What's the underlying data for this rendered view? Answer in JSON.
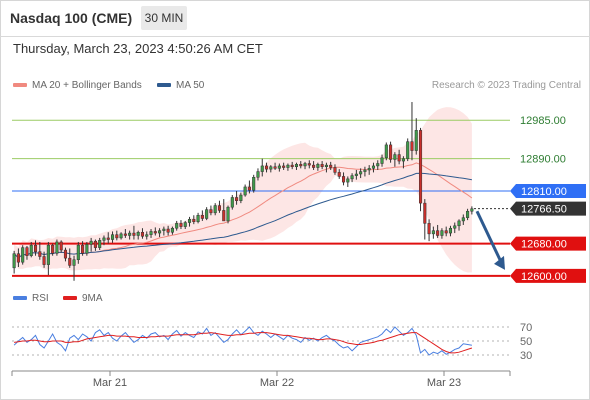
{
  "header": {
    "instrument": "Nasdaq 100 (CME)",
    "timeframe": "30 MIN",
    "timestamp": "Thursday, March 23, 2023 4:50:26 AM CET"
  },
  "legend": {
    "ma20_label": "MA 20 + Bollinger Bands",
    "ma20_color": "#f08a80",
    "ma50_label": "MA 50",
    "ma50_color": "#2e5a8f",
    "credit": "Research © 2023 Trading Central"
  },
  "rsi_legend": {
    "rsi_label": "RSI",
    "rsi_color": "#4a7fe0",
    "ma_label": "9MA",
    "ma_color": "#e02020"
  },
  "chart_data": [
    {
      "type": "candlestick",
      "title": "Nasdaq 100 (CME) 30 MIN",
      "x_labels": [
        "Mar 21",
        "Mar 22",
        "Mar 23"
      ],
      "ylim": [
        12585,
        13035
      ],
      "grid": false,
      "levels": [
        {
          "label": "12985.00",
          "value": 12985,
          "kind": "resistance",
          "color": "#9ccc65"
        },
        {
          "label": "12890.00",
          "value": 12890,
          "kind": "resistance",
          "color": "#9ccc65"
        },
        {
          "label": "12810.00",
          "value": 12810,
          "kind": "pivot",
          "color": "#2f6ff5"
        },
        {
          "label": "12766.50",
          "value": 12766.5,
          "kind": "last_price",
          "color": "#333333"
        },
        {
          "label": "12680.00",
          "value": 12680,
          "kind": "support",
          "color": "#e01010"
        },
        {
          "label": "12600.00",
          "value": 12600,
          "kind": "support",
          "color": "#e01010"
        }
      ],
      "forecast_arrow": {
        "from": 12760,
        "to": 12615,
        "direction": "down",
        "color": "#2e5a8f"
      },
      "candles": [
        [
          12620,
          12662,
          12606,
          12655
        ],
        [
          12655,
          12668,
          12622,
          12634
        ],
        [
          12634,
          12676,
          12628,
          12670
        ],
        [
          12670,
          12674,
          12640,
          12650
        ],
        [
          12650,
          12684,
          12646,
          12676
        ],
        [
          12676,
          12688,
          12650,
          12660
        ],
        [
          12660,
          12684,
          12640,
          12648
        ],
        [
          12648,
          12660,
          12620,
          12628
        ],
        [
          12628,
          12684,
          12602,
          12676
        ],
        [
          12676,
          12680,
          12650,
          12656
        ],
        [
          12656,
          12690,
          12650,
          12684
        ],
        [
          12684,
          12688,
          12658,
          12664
        ],
        [
          12664,
          12670,
          12636,
          12644
        ],
        [
          12644,
          12668,
          12620,
          12626
        ],
        [
          12626,
          12650,
          12588,
          12640
        ],
        [
          12640,
          12684,
          12630,
          12676
        ],
        [
          12676,
          12686,
          12650,
          12656
        ],
        [
          12656,
          12684,
          12650,
          12678
        ],
        [
          12678,
          12694,
          12660,
          12686
        ],
        [
          12686,
          12690,
          12662,
          12670
        ],
        [
          12670,
          12694,
          12664,
          12688
        ],
        [
          12688,
          12700,
          12676,
          12694
        ],
        [
          12694,
          12708,
          12680,
          12690
        ],
        [
          12690,
          12710,
          12682,
          12702
        ],
        [
          12702,
          12712,
          12688,
          12694
        ],
        [
          12694,
          12708,
          12690,
          12704
        ],
        [
          12704,
          12716,
          12694,
          12700
        ],
        [
          12700,
          12712,
          12690,
          12706
        ],
        [
          12706,
          12724,
          12690,
          12700
        ],
        [
          12700,
          12712,
          12690,
          12708
        ],
        [
          12708,
          12718,
          12692,
          12698
        ],
        [
          12698,
          12710,
          12690,
          12702
        ],
        [
          12702,
          12716,
          12694,
          12710
        ],
        [
          12710,
          12720,
          12700,
          12706
        ],
        [
          12706,
          12718,
          12696,
          12712
        ],
        [
          12712,
          12722,
          12700,
          12716
        ],
        [
          12716,
          12724,
          12700,
          12708
        ],
        [
          12708,
          12722,
          12702,
          12718
        ],
        [
          12718,
          12736,
          12712,
          12730
        ],
        [
          12730,
          12738,
          12716,
          12722
        ],
        [
          12722,
          12736,
          12716,
          12732
        ],
        [
          12732,
          12746,
          12722,
          12740
        ],
        [
          12740,
          12750,
          12728,
          12734
        ],
        [
          12734,
          12756,
          12730,
          12750
        ],
        [
          12750,
          12762,
          12736,
          12742
        ],
        [
          12742,
          12770,
          12738,
          12764
        ],
        [
          12764,
          12774,
          12750,
          12756
        ],
        [
          12756,
          12780,
          12750,
          12774
        ],
        [
          12774,
          12786,
          12756,
          12762
        ],
        [
          12762,
          12790,
          12744,
          12736
        ],
        [
          12736,
          12774,
          12730,
          12770
        ],
        [
          12770,
          12800,
          12764,
          12794
        ],
        [
          12794,
          12810,
          12776,
          12786
        ],
        [
          12786,
          12806,
          12780,
          12800
        ],
        [
          12800,
          12826,
          12796,
          12820
        ],
        [
          12820,
          12836,
          12804,
          12812
        ],
        [
          12812,
          12850,
          12806,
          12844
        ],
        [
          12844,
          12866,
          12836,
          12858
        ],
        [
          12858,
          12890,
          12846,
          12872
        ],
        [
          12872,
          12880,
          12856,
          12864
        ],
        [
          12864,
          12874,
          12856,
          12870
        ],
        [
          12870,
          12880,
          12862,
          12866
        ],
        [
          12866,
          12878,
          12858,
          12872
        ],
        [
          12872,
          12880,
          12862,
          12868
        ],
        [
          12868,
          12878,
          12860,
          12874
        ],
        [
          12874,
          12882,
          12864,
          12870
        ],
        [
          12870,
          12880,
          12862,
          12876
        ],
        [
          12876,
          12884,
          12866,
          12872
        ],
        [
          12872,
          12882,
          12864,
          12878
        ],
        [
          12878,
          12886,
          12866,
          12874
        ],
        [
          12874,
          12884,
          12862,
          12868
        ],
        [
          12868,
          12880,
          12860,
          12876
        ],
        [
          12876,
          12884,
          12864,
          12870
        ],
        [
          12870,
          12880,
          12856,
          12874
        ],
        [
          12874,
          12882,
          12862,
          12868
        ],
        [
          12868,
          12876,
          12850,
          12856
        ],
        [
          12856,
          12864,
          12840,
          12846
        ],
        [
          12846,
          12856,
          12824,
          12832
        ],
        [
          12832,
          12846,
          12820,
          12840
        ],
        [
          12840,
          12854,
          12832,
          12848
        ],
        [
          12848,
          12862,
          12838,
          12852
        ],
        [
          12852,
          12866,
          12842,
          12858
        ],
        [
          12858,
          12870,
          12846,
          12862
        ],
        [
          12862,
          12874,
          12850,
          12866
        ],
        [
          12866,
          12880,
          12856,
          12872
        ],
        [
          12872,
          12886,
          12862,
          12878
        ],
        [
          12878,
          12900,
          12870,
          12892
        ],
        [
          12892,
          12930,
          12886,
          12924
        ],
        [
          12924,
          12932,
          12880,
          12888
        ],
        [
          12888,
          12906,
          12870,
          12900
        ],
        [
          12900,
          12912,
          12876,
          12884
        ],
        [
          12884,
          12896,
          12866,
          12890
        ],
        [
          12890,
          12940,
          12884,
          12932
        ],
        [
          12932,
          13030,
          12886,
          12910
        ],
        [
          12910,
          12990,
          12900,
          12960
        ],
        [
          12960,
          12966,
          12760,
          12780
        ],
        [
          12780,
          12790,
          12690,
          12730
        ],
        [
          12730,
          12740,
          12686,
          12704
        ],
        [
          12704,
          12722,
          12692,
          12712
        ],
        [
          12712,
          12726,
          12694,
          12700
        ],
        [
          12700,
          12718,
          12692,
          12712
        ],
        [
          12712,
          12722,
          12698,
          12706
        ],
        [
          12706,
          12724,
          12698,
          12718
        ],
        [
          12718,
          12732,
          12706,
          12724
        ],
        [
          12724,
          12740,
          12712,
          12736
        ],
        [
          12736,
          12752,
          12726,
          12744
        ],
        [
          12744,
          12766,
          12738,
          12760
        ],
        [
          12760,
          12772,
          12752,
          12766
        ]
      ]
    },
    {
      "type": "line",
      "title": "RSI",
      "ylim": [
        20,
        80
      ],
      "ticks": [
        70,
        50,
        30
      ],
      "series": [
        {
          "name": "RSI",
          "values": [
            44,
            50,
            55,
            48,
            52,
            58,
            45,
            40,
            50,
            60,
            48,
            44,
            36,
            54,
            58,
            52,
            60,
            56,
            50,
            62,
            66,
            58,
            62,
            54,
            50,
            57,
            62,
            55,
            48,
            52,
            58,
            54,
            60,
            62,
            56,
            58,
            52,
            60,
            65,
            57,
            62,
            58,
            55,
            63,
            60,
            68,
            58,
            62,
            55,
            48,
            52,
            60,
            66,
            59,
            64,
            70,
            62,
            58,
            64,
            60,
            55,
            60,
            56,
            52,
            58,
            54,
            52,
            48,
            55,
            51,
            54,
            50,
            55,
            58,
            53,
            50,
            44,
            40,
            42,
            36,
            42,
            48,
            50,
            52,
            54,
            56,
            60,
            67,
            62,
            70,
            64,
            58,
            62,
            68,
            58,
            33,
            38,
            30,
            34,
            32,
            36,
            31,
            34,
            38,
            40,
            46,
            45,
            44
          ]
        },
        {
          "name": "9MA",
          "values": [
            48,
            49,
            50,
            50,
            51,
            51,
            50,
            49,
            49,
            50,
            50,
            50,
            48,
            48,
            49,
            49,
            51,
            53,
            54,
            55,
            56,
            57,
            58,
            58,
            57,
            57,
            57,
            56,
            56,
            55,
            55,
            55,
            56,
            56,
            57,
            57,
            57,
            58,
            59,
            59,
            59,
            59,
            59,
            60,
            61,
            61,
            62,
            61,
            60,
            59,
            58,
            58,
            59,
            59,
            60,
            61,
            61,
            62,
            62,
            62,
            61,
            60,
            59,
            58,
            58,
            57,
            56,
            55,
            54,
            54,
            53,
            52,
            52,
            53,
            53,
            52,
            51,
            49,
            47,
            46,
            45,
            45,
            46,
            47,
            48,
            50,
            51,
            53,
            55,
            57,
            59,
            60,
            61,
            62,
            62,
            58,
            54,
            50,
            46,
            42,
            38,
            35,
            33,
            33,
            34,
            36,
            38,
            40
          ]
        }
      ]
    }
  ]
}
